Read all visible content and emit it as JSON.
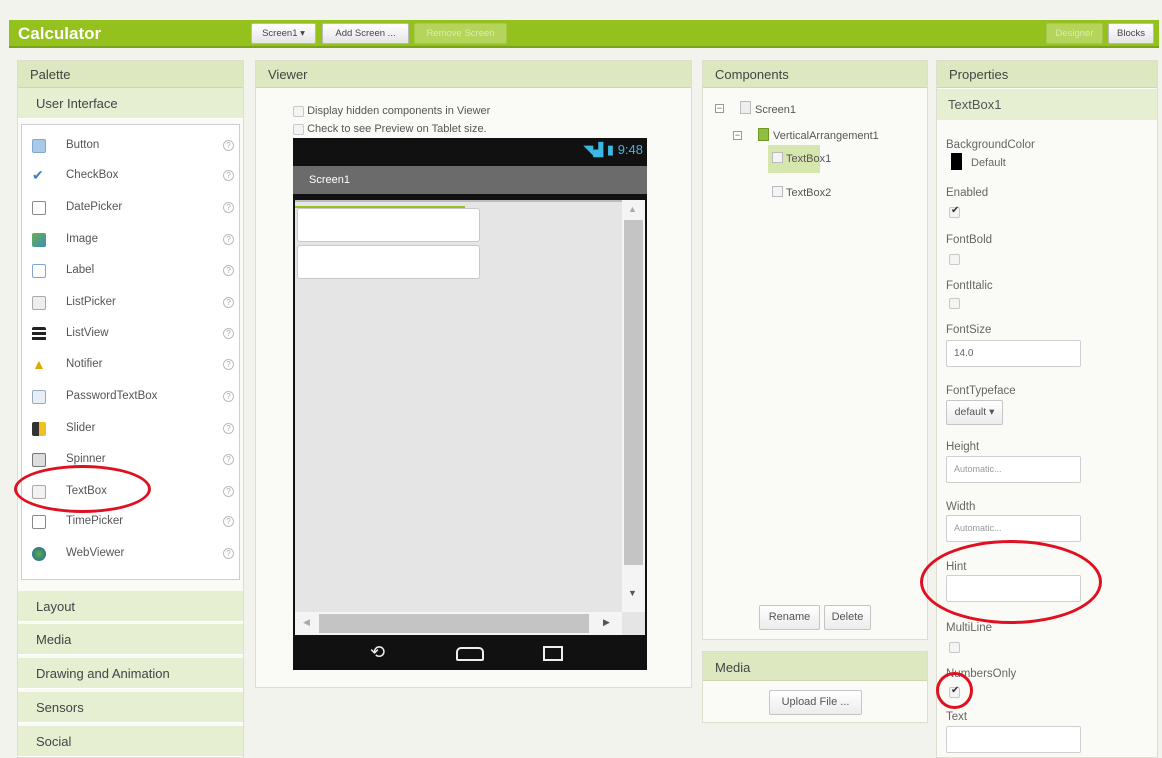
{
  "app": {
    "title": "Calculator"
  },
  "toolbar": {
    "screen_select": "Screen1 ▾",
    "add_screen": "Add Screen ...",
    "remove_screen": "Remove Screen",
    "designer": "Designer",
    "blocks": "Blocks"
  },
  "palette": {
    "title": "Palette",
    "category_open": "User Interface",
    "help_glyph": "?",
    "items": [
      {
        "label": "Button",
        "icon": "button-icon"
      },
      {
        "label": "CheckBox",
        "icon": "checkbox-icon"
      },
      {
        "label": "DatePicker",
        "icon": "calendar-icon"
      },
      {
        "label": "Image",
        "icon": "image-icon"
      },
      {
        "label": "Label",
        "icon": "label-icon"
      },
      {
        "label": "ListPicker",
        "icon": "listpicker-icon"
      },
      {
        "label": "ListView",
        "icon": "listview-icon"
      },
      {
        "label": "Notifier",
        "icon": "warning-icon"
      },
      {
        "label": "PasswordTextBox",
        "icon": "password-icon"
      },
      {
        "label": "Slider",
        "icon": "slider-icon"
      },
      {
        "label": "Spinner",
        "icon": "spinner-icon"
      },
      {
        "label": "TextBox",
        "icon": "textbox-icon"
      },
      {
        "label": "TimePicker",
        "icon": "clock-icon"
      },
      {
        "label": "WebViewer",
        "icon": "globe-icon"
      }
    ],
    "categories": [
      "Layout",
      "Media",
      "Drawing and Animation",
      "Sensors",
      "Social"
    ]
  },
  "viewer": {
    "title": "Viewer",
    "hidden_label": "Display hidden components in Viewer",
    "tablet_label": "Check to see Preview on Tablet size.",
    "phone": {
      "time": "9:48",
      "screen_title": "Screen1"
    }
  },
  "components": {
    "title": "Components",
    "tree": [
      "Screen1",
      "VerticalArrangement1",
      "TextBox1",
      "TextBox2"
    ],
    "rename": "Rename",
    "delete": "Delete"
  },
  "media": {
    "title": "Media",
    "upload": "Upload File ..."
  },
  "properties": {
    "title": "Properties",
    "component": "TextBox1",
    "background_color": {
      "label": "BackgroundColor",
      "value": "Default"
    },
    "enabled": {
      "label": "Enabled",
      "checked": true
    },
    "font_bold": {
      "label": "FontBold",
      "checked": false
    },
    "font_italic": {
      "label": "FontItalic",
      "checked": false
    },
    "font_size": {
      "label": "FontSize",
      "value": "14.0"
    },
    "font_typeface": {
      "label": "FontTypeface",
      "value": "default ▾"
    },
    "height": {
      "label": "Height",
      "value": "Automatic..."
    },
    "width": {
      "label": "Width",
      "value": "Automatic..."
    },
    "hint": {
      "label": "Hint",
      "value": ""
    },
    "multiline": {
      "label": "MultiLine",
      "checked": false
    },
    "numbers_only": {
      "label": "NumbersOnly",
      "checked": true
    },
    "text": {
      "label": "Text",
      "value": ""
    }
  },
  "colors": {
    "brand": "#95c11f",
    "header": "#dde8c1",
    "annotation": "#e01020"
  }
}
